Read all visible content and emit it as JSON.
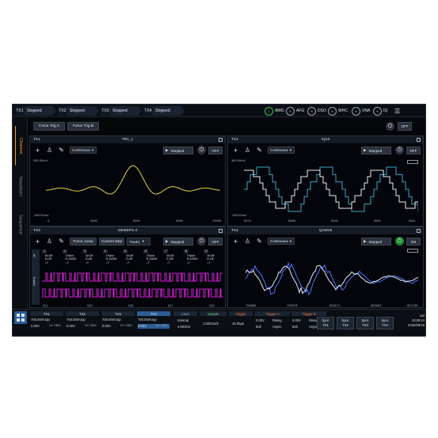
{
  "topbar": {
    "channels": [
      {
        "id": "TX1",
        "status": "Stopped"
      },
      {
        "id": "TX2",
        "status": "Stopped"
      },
      {
        "id": "TX3",
        "status": "Stopped"
      },
      {
        "id": "TX4",
        "status": "Stopped"
      }
    ],
    "apps": [
      "AWG",
      "AFG",
      "DSO",
      "WHC",
      "VNA",
      "IQ"
    ]
  },
  "sidetabs": [
    "Channel",
    "Waveform",
    "Sequence"
  ],
  "header": {
    "force_a": "Force Trig A",
    "force_b": "Force Trig B",
    "power": "OFF"
  },
  "panels": [
    {
      "id": "TX1",
      "name": "TR1_1",
      "mode": "Continuous",
      "run": "Stopped",
      "power": "OFF",
      "ytop": "350.00mV",
      "ybot": "-350.00mV",
      "xticks": [
        "0",
        "3000",
        "6000",
        "9000",
        "12000"
      ]
    },
    {
      "id": "TX2",
      "name": "IQ13",
      "mode": "Continuous",
      "run": "Stopped",
      "power": "OFF",
      "ytop": "350.00mV",
      "ybot": "-350.00mV",
      "xticks": [
        "5474",
        "5483",
        "5492",
        "5501",
        "5511"
      ]
    },
    {
      "id": "TX3",
      "name": "SWEEP3-4",
      "mode": "Force Jump",
      "run": "Stopped",
      "power": "OFF",
      "extra1": "Current step",
      "extra2": "Track1",
      "steps": [
        "1",
        "2",
        "3",
        "4",
        "5",
        "6",
        "7",
        "8",
        "9"
      ],
      "stepinfo": [
        "W:Off\nE:Off\n↓T",
        "T:Next\nR:10000\n↓T",
        "W:Off\nE:Off\n↓T",
        "T:Next\nR:10000\n↓T",
        "W:Off\nE:Off\n↓T",
        "T:Next\nR:10000\n↓T",
        "W:Off\nE:Off\n↓T",
        "T:Next\nR:10000\n↓T",
        "W:Off\nE:Off\n↓T"
      ],
      "rowlabels": [
        "ID",
        "Track1"
      ],
      "xticks": [
        "IQ1",
        "IQ3",
        "IQ5",
        "IQ7",
        "IQ9"
      ]
    },
    {
      "id": "TX4",
      "name": "QAM16",
      "mode": "Continuous",
      "run": "Stopped",
      "power": "ON",
      "xticks": [
        "799585",
        "799378",
        "800171",
        "800963",
        "801755"
      ]
    }
  ],
  "bottom": {
    "tx": [
      {
        "label": "TX1",
        "amp": "700.00mVpp",
        "off": "0.00V",
        "cpl": "DC HBW"
      },
      {
        "label": "TX2",
        "amp": "700.00mVpp",
        "off": "0.00V",
        "cpl": "DC HBW"
      },
      {
        "label": "TX3",
        "amp": "700.00mVpp",
        "off": "0.00V",
        "cpl": "DC HBW"
      },
      {
        "label": "TX4",
        "amp": "700.00mVpp",
        "off": "0.00V",
        "cpl": "DC HBW"
      }
    ],
    "clock": {
      "label": "Clock",
      "src": "Internal",
      "freq": "4.00GHz"
    },
    "sample": {
      "label": "Sample",
      "rate": "1.00GSa/s"
    },
    "trigger": {
      "label": "Trigger",
      "time": "15.00µs"
    },
    "triggerA": {
      "label": "Trigger A",
      "v1": "0.00V",
      "v2": "500",
      "e1": "Rising",
      "e2": "Async"
    },
    "triggerB": {
      "label": "Trigger B",
      "v1": "0.00V",
      "v2": "500",
      "e1": "Rising",
      "e2": "Async"
    },
    "sync": [
      {
        "l1": "Sync",
        "l2": "TX1"
      },
      {
        "l1": "Sync",
        "l2": "TX2"
      },
      {
        "l1": "Sync",
        "l2": "TX3"
      },
      {
        "l1": "Sync",
        "l2": "TX4"
      }
    ],
    "status": {
      "lan": "LW",
      "time": "10:08:44",
      "date": "2020/08/18"
    }
  },
  "colors": {
    "tx1": "#e3d53a",
    "tx2": "#3aa7c7",
    "tx3": "#d11fd1",
    "tx4": "#4b73ff"
  }
}
